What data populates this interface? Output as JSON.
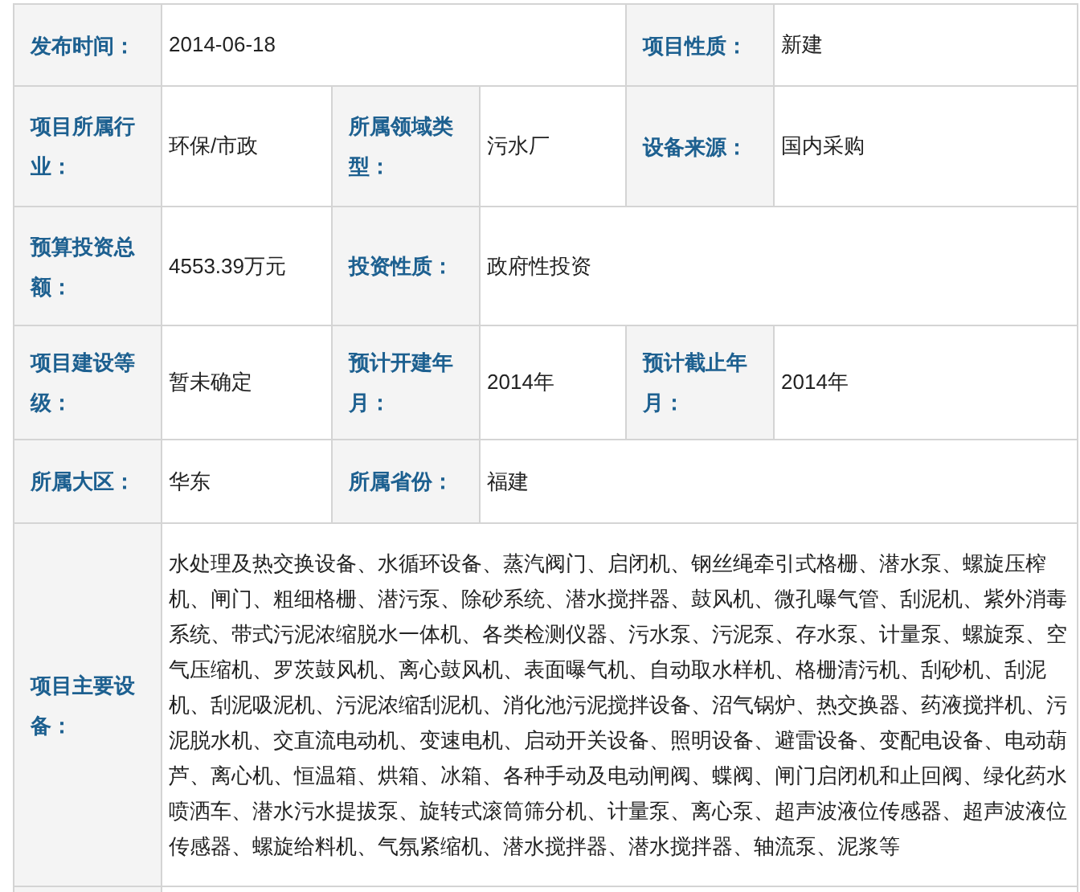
{
  "rows": [
    [
      {
        "kind": "label",
        "text": "发布时间："
      },
      {
        "kind": "wide",
        "text": "2014-06-18"
      },
      {
        "kind": "label",
        "text": "项目性质："
      },
      {
        "kind": "value",
        "text": "新建"
      }
    ],
    [
      {
        "kind": "label",
        "text": "项目所属行业："
      },
      {
        "kind": "value",
        "text": "环保/市政"
      },
      {
        "kind": "label",
        "text": "所属领域类型："
      },
      {
        "kind": "value",
        "text": "污水厂"
      },
      {
        "kind": "label",
        "text": "设备来源："
      },
      {
        "kind": "value",
        "text": "国内采购"
      }
    ],
    [
      {
        "kind": "label",
        "text": "预算投资总额："
      },
      {
        "kind": "value",
        "text": "4553.39万元"
      },
      {
        "kind": "label",
        "text": "投资性质："
      },
      {
        "kind": "wide",
        "text": "政府性投资"
      }
    ],
    [
      {
        "kind": "label",
        "text": "项目建设等级："
      },
      {
        "kind": "value",
        "text": "暂未确定"
      },
      {
        "kind": "label",
        "text": "预计开建年月："
      },
      {
        "kind": "value",
        "text": "2014年"
      },
      {
        "kind": "label",
        "text": "预计截止年月："
      },
      {
        "kind": "value",
        "text": "2014年"
      }
    ],
    [
      {
        "kind": "label",
        "text": "所属大区："
      },
      {
        "kind": "value",
        "text": "华东"
      },
      {
        "kind": "label",
        "text": "所属省份："
      },
      {
        "kind": "wide",
        "text": "福建"
      }
    ],
    [
      {
        "kind": "label",
        "text": "项目主要设备："
      },
      {
        "kind": "wide",
        "text": "水处理及热交换设备、水循环设备、蒸汽阀门、启闭机、钢丝绳牵引式格栅、潜水泵、螺旋压榨机、闸门、粗细格栅、潜污泵、除砂系统、潜水搅拌器、鼓风机、微孔曝气管、刮泥机、紫外消毒系统、带式污泥浓缩脱水一体机、各类检测仪器、污水泵、污泥泵、存水泵、计量泵、螺旋泵、空气压缩机、罗茨鼓风机、离心鼓风机、表面曝气机、自动取水样机、格栅清污机、刮砂机、刮泥机、刮泥吸泥机、污泥浓缩刮泥机、消化池污泥搅拌设备、沼气锅炉、热交换器、药液搅拌机、污泥脱水机、交直流电动机、变速电机、启动开关设备、照明设备、避雷设备、变配电设备、电动葫芦、离心机、恒温箱、烘箱、冰箱、各种手动及电动闸阀、蝶阀、闸门启闭机和止回阀、绿化药水喷洒车、潜水污水提拔泵、旋转式滚筒筛分机、计量泵、离心泵、超声波液位传感器、超声波液位传感器、螺旋给料机、气氛紧缩机、潜水搅拌器、潜水搅拌器、轴流泵、泥浆等"
      }
    ]
  ]
}
